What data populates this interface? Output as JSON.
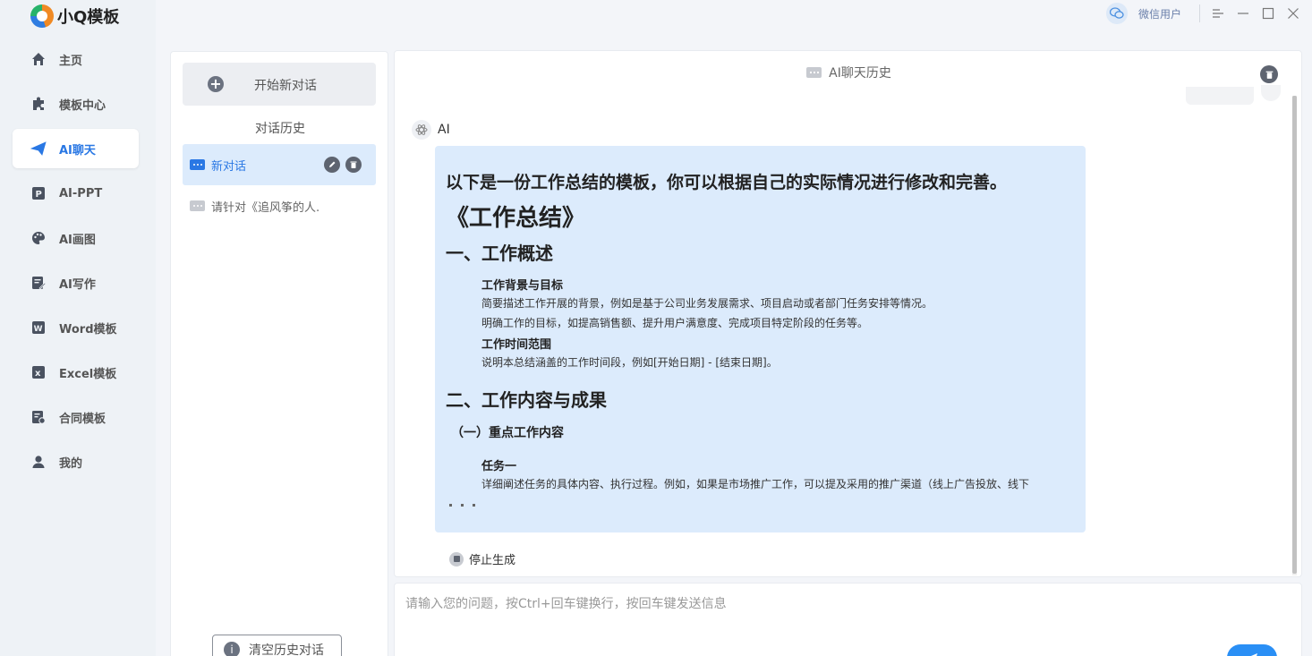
{
  "app": {
    "logo_text": "小Q模板"
  },
  "titlebar": {
    "user_name": "微信用户"
  },
  "nav": [
    {
      "label": "主页",
      "icon": "home-icon"
    },
    {
      "label": "模板中心",
      "icon": "puzzle-icon"
    },
    {
      "label": "AI聊天",
      "icon": "paper-plane-icon",
      "active": true
    },
    {
      "label": "AI-PPT",
      "icon": "ppt-icon"
    },
    {
      "label": "AI画图",
      "icon": "palette-icon"
    },
    {
      "label": "AI写作",
      "icon": "edit-document-icon"
    },
    {
      "label": "Word模板",
      "icon": "word-icon"
    },
    {
      "label": "Excel模板",
      "icon": "excel-icon"
    },
    {
      "label": "合同模板",
      "icon": "contract-icon"
    },
    {
      "label": "我的",
      "icon": "user-icon"
    }
  ],
  "history": {
    "new_chat_label": "开始新对话",
    "title": "对话历史",
    "items": [
      {
        "label": "新对话",
        "active": true
      },
      {
        "label": "请针对《追风筝的人.",
        "active": false
      }
    ],
    "clear_label": "清空历史对话"
  },
  "chat": {
    "title": "AI聊天历史",
    "sender": "AI",
    "message": {
      "intro": "以下是一份工作总结的模板，你可以根据自己的实际情况进行修改和完善。",
      "h1": "《工作总结》",
      "section1_title": "一、工作概述",
      "bg_title": "工作背景与目标",
      "bg_p1": "简要描述工作开展的背景，例如是基于公司业务发展需求、项目启动或者部门任务安排等情况。",
      "bg_p2": "明确工作的目标，如提高销售额、提升用户满意度、完成项目特定阶段的任务等。",
      "time_title": "工作时间范围",
      "time_p": "说明本总结涵盖的工作时间段，例如[开始日期] - [结束日期]。",
      "section2_title": "二、工作内容与成果",
      "sub1_title": "（一）重点工作内容",
      "task1_title": "任务一",
      "task1_p": "详细阐述任务的具体内容、执行过程。例如，如果是市场推广工作，可以提及采用的推广渠道（线上广告投放、线下"
    },
    "stop_label": "停止生成"
  },
  "input": {
    "placeholder": "请输入您的问题，按Ctrl+回车键换行，按回车键发送信息"
  },
  "colors": {
    "accent": "#2a78e4",
    "bubble": "#dcebfc",
    "sidebar": "#eef2f6"
  }
}
